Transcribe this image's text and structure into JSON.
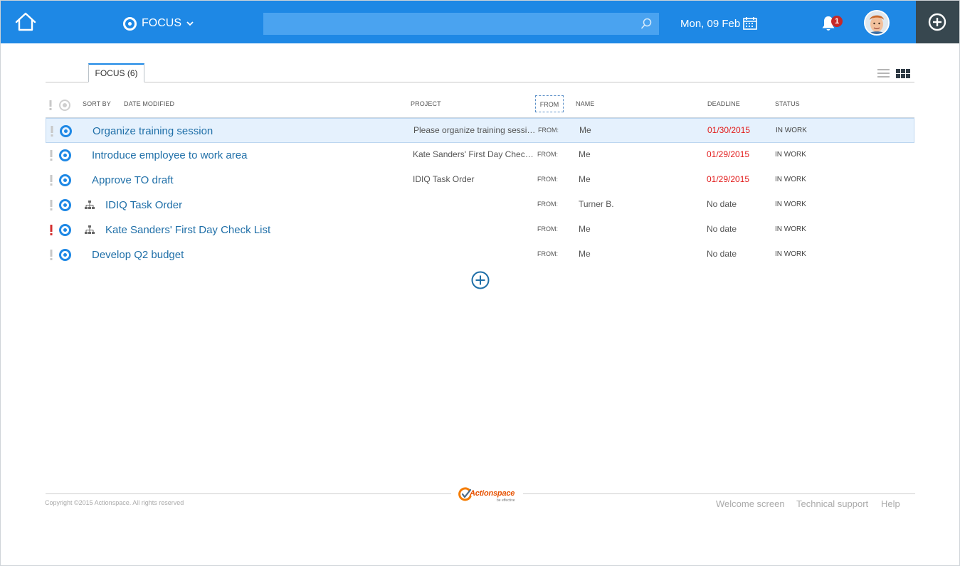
{
  "header": {
    "focus_label": "FOCUS",
    "search_placeholder": "",
    "date": "Mon, 09 Feb",
    "notification_count": "1",
    "brand_color": "#1e88e5",
    "icons": {
      "home": "home-icon",
      "focus": "focus-target-icon",
      "chevron": "chevron-down-icon",
      "search": "search-icon",
      "calendar": "calendar-icon",
      "bell": "bell-icon",
      "add": "plus-circle-icon"
    }
  },
  "tabs": [
    {
      "label": "FOCUS (6)"
    }
  ],
  "columns": {
    "sort_by": "SORT BY",
    "date_modified": "DATE MODIFIED",
    "project": "PROJECT",
    "from": "FROM",
    "name": "NAME",
    "deadline": "DEADLINE",
    "status": "STATUS"
  },
  "tasks": [
    {
      "title": "Organize training session",
      "project": "Please organize training session for the new employees",
      "from_label": "FROM:",
      "name": "Me",
      "deadline": "01/30/2015",
      "overdue": true,
      "status": "IN WORK",
      "important": false,
      "has_subtasks": false
    },
    {
      "title": "Introduce employee to work area",
      "project": "Kate Sanders' First Day Check List",
      "from_label": "FROM:",
      "name": "Me",
      "deadline": "01/29/2015",
      "overdue": true,
      "status": "IN WORK",
      "important": false,
      "has_subtasks": false
    },
    {
      "title": "Approve TO draft",
      "project": "IDIQ Task Order",
      "from_label": "FROM:",
      "name": "Me",
      "deadline": "01/29/2015",
      "overdue": true,
      "status": "IN WORK",
      "important": false,
      "has_subtasks": false
    },
    {
      "title": "IDIQ Task Order",
      "project": "",
      "from_label": "FROM:",
      "name": "Turner B.",
      "deadline": "No date",
      "overdue": false,
      "status": "IN WORK",
      "important": false,
      "has_subtasks": true
    },
    {
      "title": "Kate Sanders' First Day Check List",
      "project": "",
      "from_label": "FROM:",
      "name": "Me",
      "deadline": "No date",
      "overdue": false,
      "status": "IN WORK",
      "important": true,
      "has_subtasks": true
    },
    {
      "title": "Develop Q2 budget",
      "project": "",
      "from_label": "FROM:",
      "name": "Me",
      "deadline": "No date",
      "overdue": false,
      "status": "IN WORK",
      "important": false,
      "has_subtasks": false
    }
  ],
  "footer": {
    "copyright": "Copyright ©2015 Actionspace. All rights reserved",
    "logo_text": "Actionspace",
    "logo_tagline": "be effective",
    "links": [
      "Welcome screen",
      "Technical support",
      "Help"
    ]
  }
}
